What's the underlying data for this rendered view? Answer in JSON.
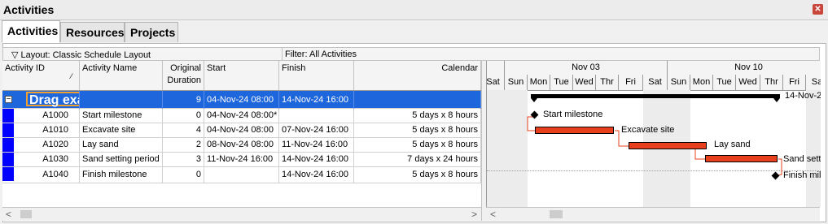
{
  "window": {
    "title": "Activities"
  },
  "tabs": [
    "Activities",
    "Resources",
    "Projects"
  ],
  "layout_bar": {
    "layout": "Layout: Classic Schedule Layout",
    "filter": "Filter: All Activities"
  },
  "columns": {
    "activity_id": "Activity ID",
    "activity_name": "Activity Name",
    "orig_dur_1": "Original",
    "orig_dur_2": "Duration",
    "start": "Start",
    "finish": "Finish",
    "calendar": "Calendar"
  },
  "wbs": {
    "name": "Drag example",
    "duration": "9",
    "start": "04-Nov-24 08:00",
    "finish": "14-Nov-24 16:00",
    "toggle": "−"
  },
  "rows": [
    {
      "id": "A1000",
      "name": "Start milestone",
      "dur": "0",
      "start": "04-Nov-24 08:00*",
      "finish": "",
      "cal": "5 days x 8 hours"
    },
    {
      "id": "A1010",
      "name": "Excavate site",
      "dur": "4",
      "start": "04-Nov-24 08:00",
      "finish": "07-Nov-24 16:00",
      "cal": "5 days x 8 hours"
    },
    {
      "id": "A1020",
      "name": "Lay sand",
      "dur": "2",
      "start": "08-Nov-24 08:00",
      "finish": "11-Nov-24 16:00",
      "cal": "5 days x 8 hours"
    },
    {
      "id": "A1030",
      "name": "Sand setting period",
      "dur": "3",
      "start": "11-Nov-24 16:00",
      "finish": "14-Nov-24 16:00",
      "cal": "7 days x 24 hours"
    },
    {
      "id": "A1040",
      "name": "Finish milestone",
      "dur": "0",
      "start": "",
      "finish": "14-Nov-24 16:00",
      "cal": "5 days x 8 hours"
    }
  ],
  "gantt": {
    "weeks": [
      "Nov 03",
      "Nov 10"
    ],
    "days": [
      "Sat",
      "Sun",
      "Mon",
      "Tue",
      "Wed",
      "Thr",
      "Fri",
      "Sat",
      "Sun",
      "Mon",
      "Tue",
      "Wed",
      "Thr",
      "Fri",
      "Sa"
    ],
    "wbs_label": "14-Nov-2",
    "labels": [
      "Start milestone",
      "Excavate site",
      "Lay sand",
      "Sand sett",
      "Finish mile"
    ]
  },
  "colors": {
    "wbs_row": "#1e66dc",
    "bar": "#e8401c",
    "critical_link": "#e8401c"
  }
}
